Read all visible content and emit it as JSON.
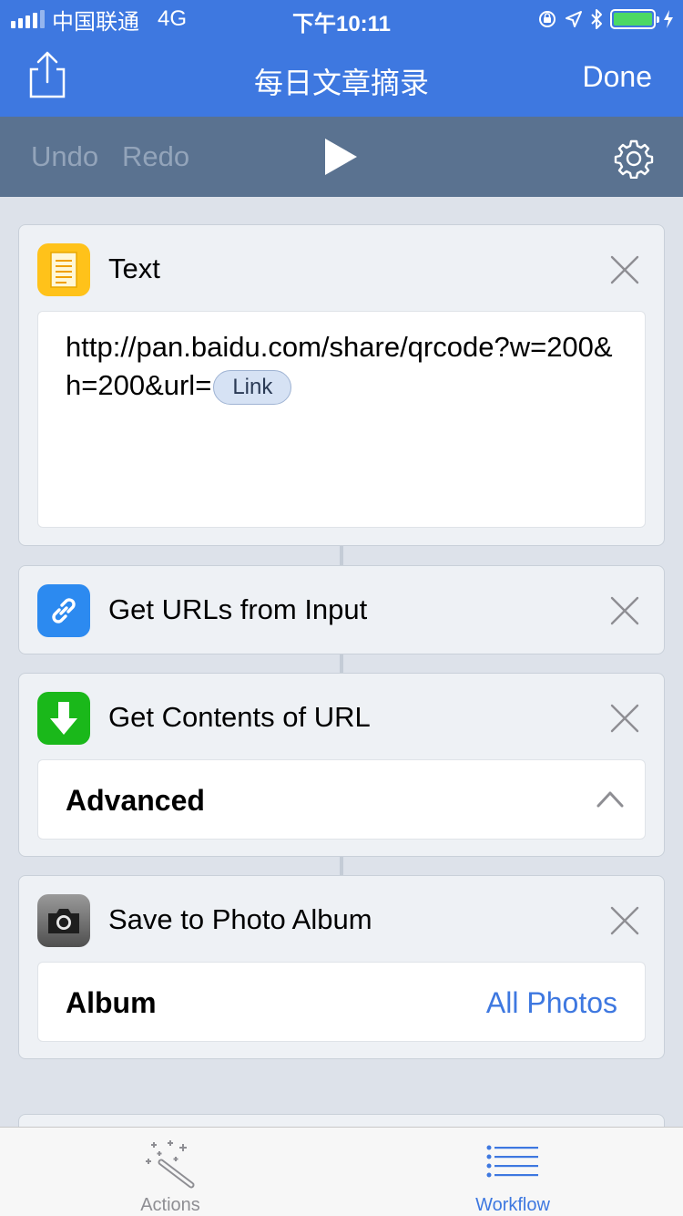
{
  "status_bar": {
    "carrier": "中国联通",
    "network": "4G",
    "time": "下午10:11",
    "battery_color": "#4cd964"
  },
  "nav": {
    "title": "每日文章摘录",
    "done_label": "Done",
    "share_icon": "share-icon"
  },
  "toolbar": {
    "undo_label": "Undo",
    "redo_label": "Redo",
    "play_icon": "play-icon",
    "settings_icon": "gear-icon"
  },
  "actions": [
    {
      "title": "Text",
      "icon": "text-document-icon",
      "icon_color": "#ffc21a",
      "text_value": "http://pan.baidu.com/share/qrcode?w=200&h=200&url=",
      "variable_label": "Link"
    },
    {
      "title": "Get URLs from Input",
      "icon": "link-icon",
      "icon_color": "#2c8af0"
    },
    {
      "title": "Get Contents of URL",
      "icon": "download-arrow-icon",
      "icon_color": "#1ab81a",
      "row_label": "Advanced"
    },
    {
      "title": "Save to Photo Album",
      "icon": "camera-icon",
      "icon_color": "#6a6a6a",
      "row_label": "Album",
      "row_value": "All Photos"
    }
  ],
  "tab_bar": {
    "actions_label": "Actions",
    "workflow_label": "Workflow",
    "active_color": "#3e78e0",
    "inactive_color": "#8e8e93"
  },
  "colors": {
    "header_blue": "#3e78e0",
    "toolbar_slate": "#5a7290",
    "canvas": "#dde2ea"
  }
}
